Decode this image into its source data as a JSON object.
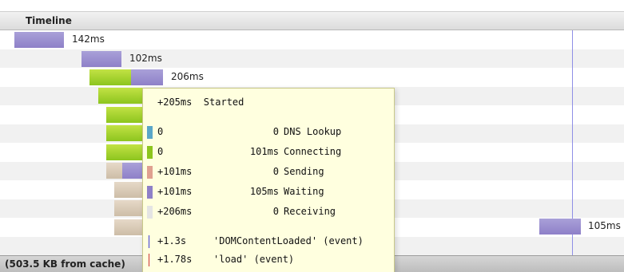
{
  "header": {
    "title": "Timeline"
  },
  "timeline": {
    "rows": [
      {
        "bars": [
          {
            "color": "purple",
            "fill_start_ms": 0,
            "fill_end_ms": 142
          }
        ],
        "label": "142ms"
      },
      {
        "bars": [
          {
            "color": "purple"
          }
        ],
        "label": "102ms"
      },
      {
        "bars": [
          {
            "color": "green"
          },
          {
            "color": "purple"
          }
        ],
        "label": "206ms"
      },
      {
        "bars": [
          {
            "color": "green"
          }
        ]
      },
      {
        "bars": [
          {
            "color": "green"
          }
        ]
      },
      {
        "bars": [
          {
            "color": "green"
          }
        ]
      },
      {
        "bars": [
          {
            "color": "green"
          }
        ]
      },
      {
        "bars": [
          {
            "color": "tan"
          },
          {
            "color": "purple"
          }
        ]
      },
      {
        "bars": [
          {
            "color": "tan"
          }
        ]
      },
      {
        "bars": [
          {
            "color": "tan"
          }
        ]
      },
      {
        "bars": [
          {
            "color": "tan"
          }
        ]
      },
      {
        "bars": [
          {
            "color": "purple"
          }
        ],
        "label": "105ms"
      }
    ],
    "marker_color": "#8f8fe6"
  },
  "footer": {
    "text": "(503.5 KB from cache)"
  },
  "tooltip": {
    "started": "+205ms  Started",
    "phases": [
      {
        "start": "0",
        "duration": "0",
        "name": "DNS Lookup",
        "color": "#5aa6c8"
      },
      {
        "start": "0",
        "duration": "101ms",
        "name": "Connecting",
        "color": "#8dc51e"
      },
      {
        "start": "+101ms",
        "duration": "0",
        "name": "Sending",
        "color": "#e0a090"
      },
      {
        "start": "+101ms",
        "duration": "105ms",
        "name": "Waiting",
        "color": "#8e80c8"
      },
      {
        "start": "+206ms",
        "duration": "0",
        "name": "Receiving",
        "color": "#e4e4e4"
      }
    ],
    "events": [
      {
        "time": "+1.3s",
        "name": "'DOMContentLoaded' (event)",
        "color": "#3a3ad6"
      },
      {
        "time": "+1.78s",
        "name": "'load' (event)",
        "color": "#cc3333"
      }
    ]
  }
}
